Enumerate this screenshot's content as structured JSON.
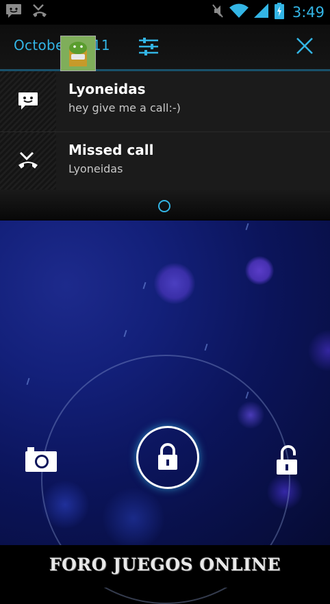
{
  "status_bar": {
    "time": "3:49",
    "colors": {
      "accent": "#33b5e5"
    },
    "left_icons": [
      "message-icon",
      "missed-call-icon"
    ],
    "right_icons": [
      "mute-icon",
      "wifi-icon",
      "signal-icon",
      "battery-charging-icon"
    ]
  },
  "shade": {
    "date": "October 2011",
    "settings_icon": "settings-sliders-icon",
    "close_icon": "close-icon"
  },
  "notifications": [
    {
      "icon": "message-icon",
      "title": "Lyoneidas",
      "text": "hey give me a call:-)"
    },
    {
      "icon": "missed-call-icon",
      "title": "Missed call",
      "text": "Lyoneidas"
    }
  ],
  "lockscreen": {
    "left_target": "camera-icon",
    "center_handle": "lock-icon",
    "right_target": "unlock-icon"
  },
  "footer": {
    "watermark": "FORO JUEGOS ONLINE"
  }
}
